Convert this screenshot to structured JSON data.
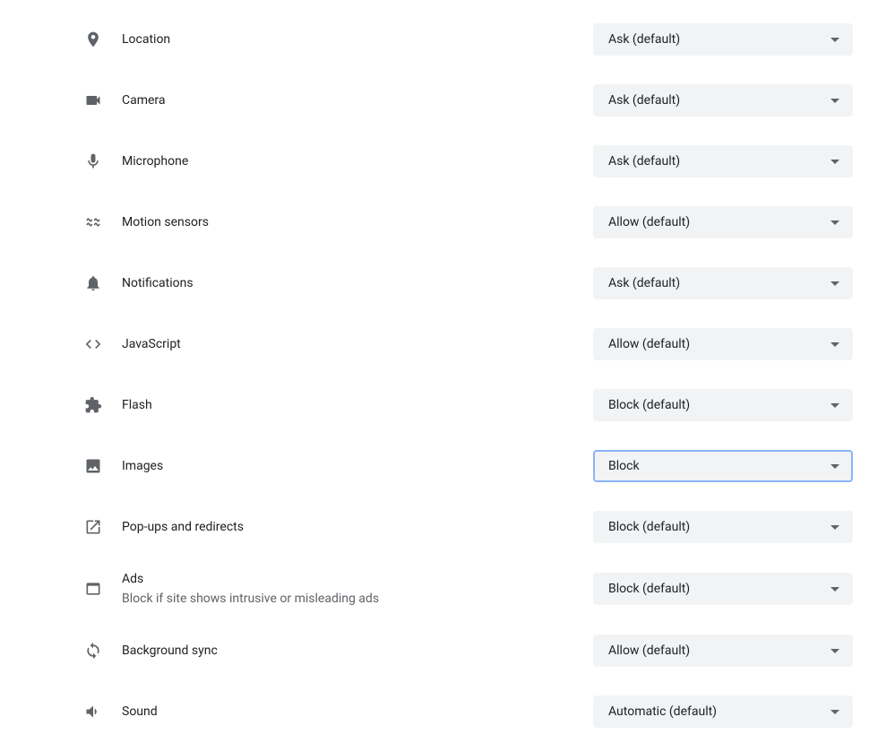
{
  "permissions": [
    {
      "id": "location",
      "icon": "location-icon",
      "label": "Location",
      "value": "Ask (default)",
      "focused": false
    },
    {
      "id": "camera",
      "icon": "camera-icon",
      "label": "Camera",
      "value": "Ask (default)",
      "focused": false
    },
    {
      "id": "microphone",
      "icon": "microphone-icon",
      "label": "Microphone",
      "value": "Ask (default)",
      "focused": false
    },
    {
      "id": "motion",
      "icon": "motion-icon",
      "label": "Motion sensors",
      "value": "Allow (default)",
      "focused": false
    },
    {
      "id": "notifications",
      "icon": "bell-icon",
      "label": "Notifications",
      "value": "Ask (default)",
      "focused": false
    },
    {
      "id": "javascript",
      "icon": "code-icon",
      "label": "JavaScript",
      "value": "Allow (default)",
      "focused": false
    },
    {
      "id": "flash",
      "icon": "plugin-icon",
      "label": "Flash",
      "value": "Block (default)",
      "focused": false
    },
    {
      "id": "images",
      "icon": "image-icon",
      "label": "Images",
      "value": "Block",
      "focused": true
    },
    {
      "id": "popups",
      "icon": "popup-icon",
      "label": "Pop-ups and redirects",
      "value": "Block (default)",
      "focused": false
    },
    {
      "id": "ads",
      "icon": "ads-icon",
      "label": "Ads",
      "sub": "Block if site shows intrusive or misleading ads",
      "value": "Block (default)",
      "focused": false
    },
    {
      "id": "bgsync",
      "icon": "sync-icon",
      "label": "Background sync",
      "value": "Allow (default)",
      "focused": false
    },
    {
      "id": "sound",
      "icon": "sound-icon",
      "label": "Sound",
      "value": "Automatic (default)",
      "focused": false
    }
  ]
}
